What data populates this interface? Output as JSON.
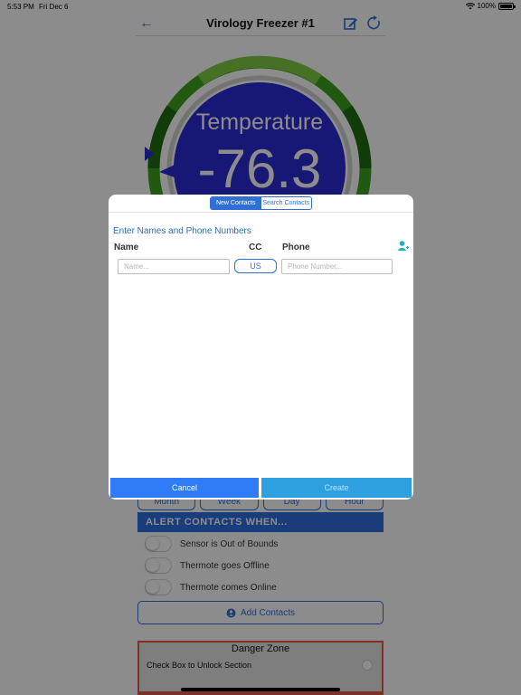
{
  "status_bar": {
    "time": "5:53 PM",
    "date": "Fri Dec 6",
    "battery": "100%"
  },
  "header": {
    "title": "Virology Freezer #1"
  },
  "gauge": {
    "label": "Temperature",
    "value": "-76.3"
  },
  "range_buttons": [
    "Month",
    "Week",
    "Day",
    "Hour"
  ],
  "alerts": {
    "header": "ALERT CONTACTS WHEN...",
    "options": [
      "Sensor is Out of Bounds",
      "Thermote goes Offline",
      "Thermote comes Online"
    ],
    "add_contacts": "Add Contacts"
  },
  "danger_zone": {
    "title": "Danger Zone",
    "unlock_label": "Check Box to Unlock Section"
  },
  "modal": {
    "tabs": [
      "New Contacts",
      "Search Contacts"
    ],
    "instructions": "Enter Names and Phone Numbers",
    "columns": {
      "name": "Name",
      "cc": "CC",
      "phone": "Phone"
    },
    "name_placeholder": "Name...",
    "cc_value": "US",
    "phone_placeholder": "Phone Number...",
    "cancel": "Cancel",
    "create": "Create"
  },
  "colors": {
    "accent": "#2f6fd6",
    "gauge_face": "#2a2ad6",
    "gauge_ring": "#3aa020",
    "danger": "#e25a4e"
  }
}
